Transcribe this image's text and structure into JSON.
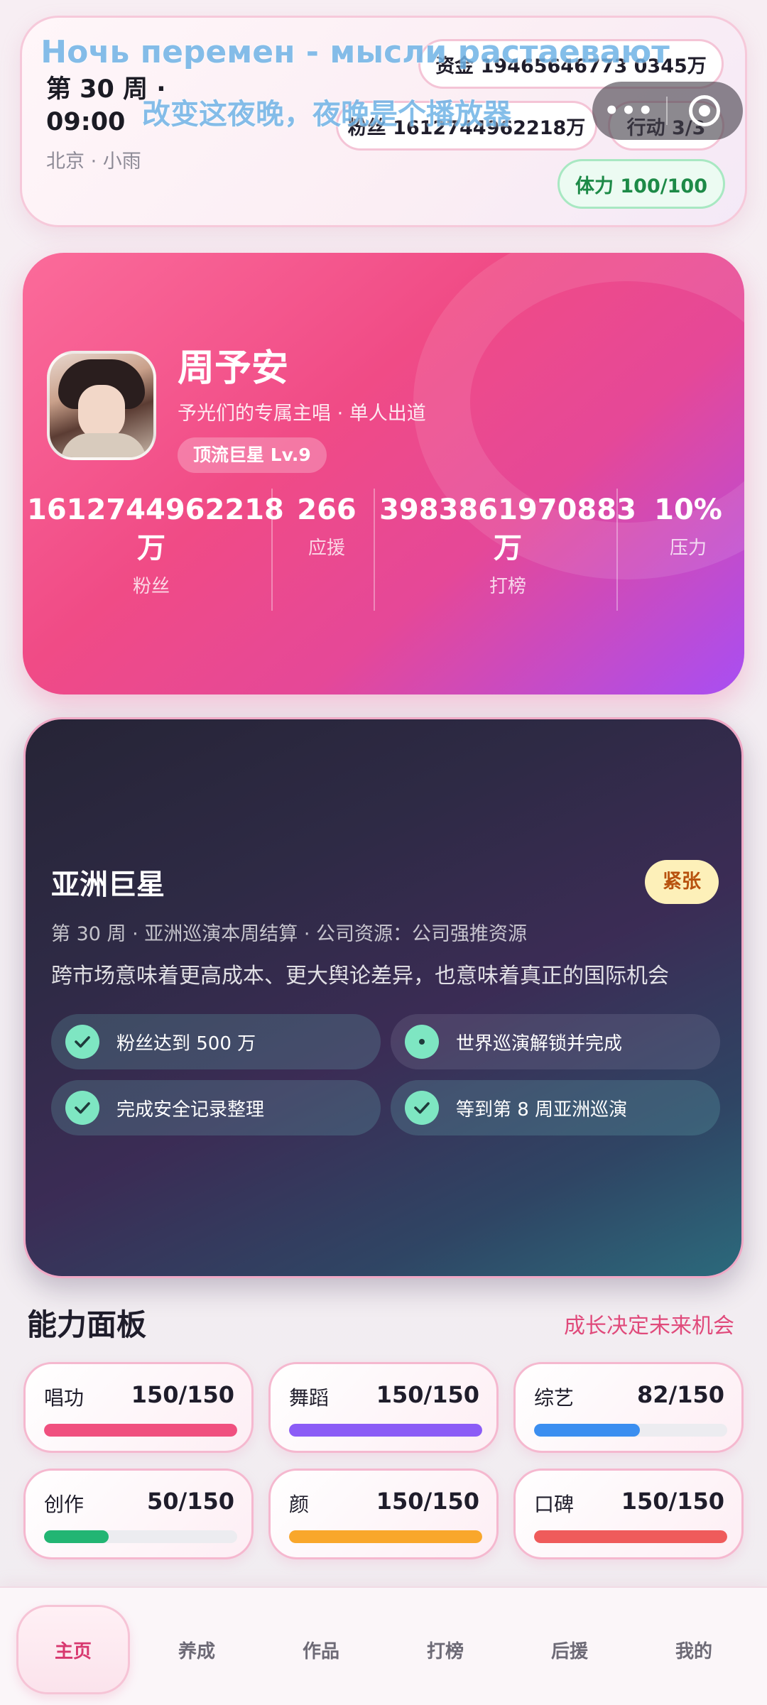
{
  "status": {
    "week_time": "第 30 周 · 09:00",
    "location_weather": "北京 · 小雨",
    "money": "资金 19465646773 0345万",
    "fans": "粉丝 1612744962218万",
    "action": "行动 3/3",
    "stamina": "体力 100/100"
  },
  "overlay": {
    "line1": "Ночь перемен - мысли растаевают",
    "line2": "改变这夜晚，夜晚是个播放器"
  },
  "capsule": {
    "more_icon": "more-dots-icon",
    "record_icon": "record-target-icon"
  },
  "profile": {
    "name": "周予安",
    "subtitle": "予光们的专属主唱 · 单人出道",
    "badge": "顶流巨星 Lv.9",
    "stats": {
      "fans_value": "1612744962218万",
      "fans_label": "粉丝",
      "support_value": "266",
      "support_label": "应援",
      "rank_value": "3983861970883万",
      "rank_label": "打榜",
      "pressure_value": "10%",
      "pressure_label": "压力"
    }
  },
  "event": {
    "title": "亚洲巨星",
    "badge": "紧张",
    "meta": "第 30 周 · 亚洲巡演本周结算 · 公司资源：公司强推资源",
    "description": "跨市场意味着更高成本、更大舆论差异，也意味着真正的国际机会",
    "goals": [
      {
        "text": "粉丝达到 500 万",
        "done": true
      },
      {
        "text": "世界巡演解锁并完成",
        "done": false
      },
      {
        "text": "完成安全记录整理",
        "done": true
      },
      {
        "text": "等到第 8 周亚洲巡演",
        "done": true
      }
    ]
  },
  "abilities": {
    "title": "能力面板",
    "hint": "成长决定未来机会",
    "items": [
      {
        "name": "唱功",
        "value": "150/150",
        "ratio": 1.0,
        "color": "#f0507f"
      },
      {
        "name": "舞蹈",
        "value": "150/150",
        "ratio": 1.0,
        "color": "#8b5cf6"
      },
      {
        "name": "综艺",
        "value": "82/150",
        "ratio": 0.547,
        "color": "#3b8ef0"
      },
      {
        "name": "创作",
        "value": "50/150",
        "ratio": 0.333,
        "color": "#22b573"
      },
      {
        "name": "颜",
        "value": "150/150",
        "ratio": 1.0,
        "color": "#f9a72b"
      },
      {
        "name": "口碑",
        "value": "150/150",
        "ratio": 1.0,
        "color": "#ef5b5b"
      }
    ]
  },
  "nav": {
    "items": [
      "主页",
      "养成",
      "作品",
      "打榜",
      "后援",
      "我的"
    ],
    "active": "主页"
  }
}
